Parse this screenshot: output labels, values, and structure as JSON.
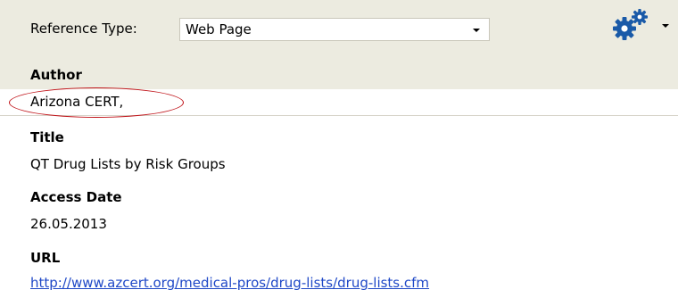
{
  "toolbar": {
    "reference_type_label": "Reference Type:",
    "reference_type_value": "Web Page",
    "settings_icon": "gears-icon"
  },
  "fields": {
    "author": {
      "label": "Author",
      "value": "Arizona CERT,"
    },
    "title": {
      "label": "Title",
      "value": "QT Drug Lists by Risk Groups"
    },
    "access_date": {
      "label": "Access Date",
      "value": "26.05.2013"
    },
    "url": {
      "label": "URL",
      "value": "http://www.azcert.org/medical-pros/drug-lists/drug-lists.cfm"
    }
  },
  "colors": {
    "panel_background": "#ecebe0",
    "link": "#1f48c7",
    "highlight": "#c0141a",
    "gear": "#1a5aa8"
  }
}
